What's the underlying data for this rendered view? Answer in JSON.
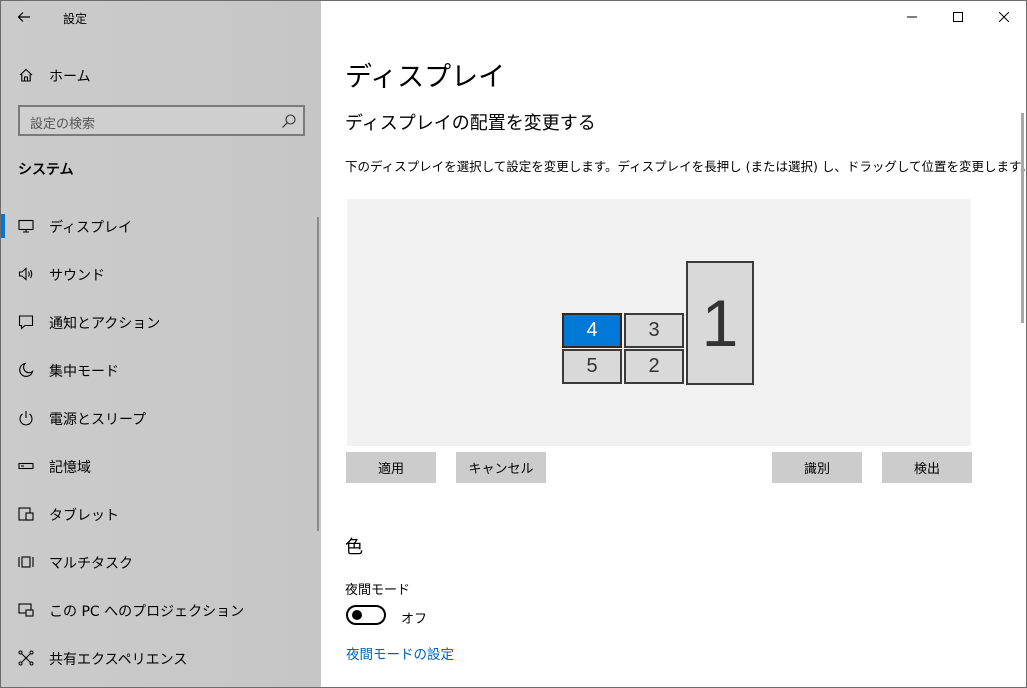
{
  "app": {
    "title": "設定"
  },
  "sidebar": {
    "home_label": "ホーム",
    "search_placeholder": "設定の検索",
    "section_title": "システム",
    "items": [
      {
        "label": "ディスプレイ",
        "icon": "monitor-icon",
        "active": true
      },
      {
        "label": "サウンド",
        "icon": "speaker-icon"
      },
      {
        "label": "通知とアクション",
        "icon": "notification-icon"
      },
      {
        "label": "集中モード",
        "icon": "moon-icon"
      },
      {
        "label": "電源とスリープ",
        "icon": "power-icon"
      },
      {
        "label": "記憶域",
        "icon": "storage-icon"
      },
      {
        "label": "タブレット",
        "icon": "tablet-icon"
      },
      {
        "label": "マルチタスク",
        "icon": "multitask-icon"
      },
      {
        "label": "この PC へのプロジェクション",
        "icon": "projection-icon"
      },
      {
        "label": "共有エクスペリエンス",
        "icon": "share-icon"
      }
    ]
  },
  "main": {
    "title": "ディスプレイ",
    "subtitle": "ディスプレイの配置を変更する",
    "description": "下のディスプレイを選択して設定を変更します。ディスプレイを長押し (または選択) し、ドラッグして位置を変更します。",
    "monitors": [
      {
        "label": "4",
        "selected": true
      },
      {
        "label": "3"
      },
      {
        "label": "1"
      },
      {
        "label": "5"
      },
      {
        "label": "2"
      }
    ],
    "buttons": {
      "apply": "適用",
      "cancel": "キャンセル",
      "identify": "識別",
      "detect": "検出"
    },
    "color_title": "色",
    "night_light_label": "夜間モード",
    "night_light_state": "オフ",
    "night_light_link": "夜間モードの設定"
  },
  "colors": {
    "accent": "#0078d7",
    "sidebar_bg": "#c9c9c9",
    "link": "#0063b1"
  }
}
